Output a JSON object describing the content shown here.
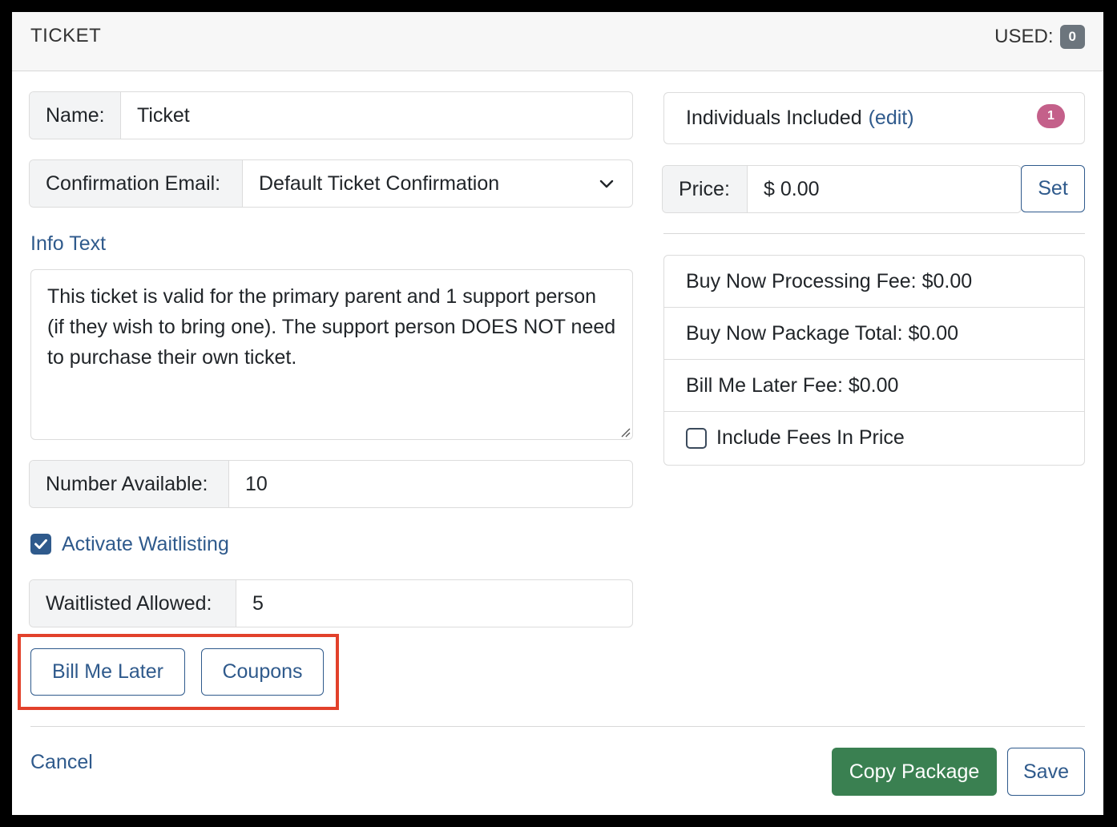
{
  "header": {
    "title": "TICKET",
    "used_label": "USED:",
    "used_count": "0"
  },
  "form": {
    "name_label": "Name:",
    "name_value": "Ticket",
    "confirmation_label": "Confirmation Email:",
    "confirmation_value": "Default Ticket Confirmation",
    "info_text_label": "Info Text",
    "info_text_value": "This ticket is valid for the primary parent and 1 support person (if they wish to bring one). The support person DOES NOT need to purchase their own ticket.",
    "number_available_label": "Number Available:",
    "number_available_value": "10",
    "activate_waitlisting_label": "Activate Waitlisting",
    "activate_waitlisting_checked": true,
    "waitlisted_allowed_label": "Waitlisted Allowed:",
    "waitlisted_allowed_value": "5"
  },
  "buttons": {
    "bill_me_later": "Bill Me Later",
    "coupons": "Coupons",
    "cancel": "Cancel",
    "copy_package": "Copy Package",
    "save": "Save"
  },
  "right": {
    "individuals_label": "Individuals Included",
    "individuals_edit": "(edit)",
    "individuals_count": "1",
    "price_label": "Price:",
    "price_value": "$ 0.00",
    "price_set": "Set",
    "fees": {
      "processing_fee": "Buy Now Processing Fee: $0.00",
      "package_total": "Buy Now Package Total: $0.00",
      "bill_later_fee": "Bill Me Later Fee: $0.00",
      "include_fees_label": "Include Fees In Price",
      "include_fees_checked": false
    }
  },
  "colors": {
    "accent": "#2f5a8c",
    "green": "#3a8051",
    "highlight": "#e2412b",
    "badge_pink": "#c4608a"
  }
}
